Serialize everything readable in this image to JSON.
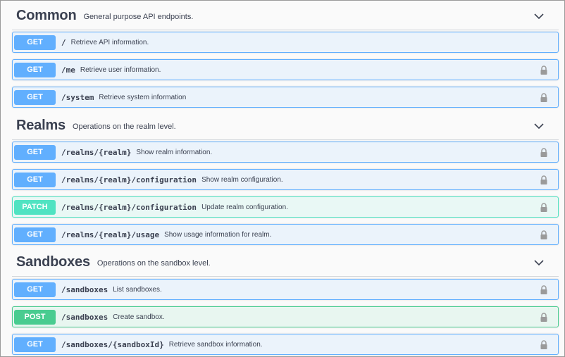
{
  "sections": [
    {
      "title": "Common",
      "description": "General purpose API endpoints.",
      "operations": [
        {
          "method": "GET",
          "path": "/",
          "summary": "Retrieve API information.",
          "locked": false
        },
        {
          "method": "GET",
          "path": "/me",
          "summary": "Retrieve user information.",
          "locked": true
        },
        {
          "method": "GET",
          "path": "/system",
          "summary": "Retrieve system information",
          "locked": true
        }
      ]
    },
    {
      "title": "Realms",
      "description": "Operations on the realm level.",
      "operations": [
        {
          "method": "GET",
          "path": "/realms/{realm}",
          "summary": "Show realm information.",
          "locked": true
        },
        {
          "method": "GET",
          "path": "/realms/{realm}/configuration",
          "summary": "Show realm configuration.",
          "locked": true
        },
        {
          "method": "PATCH",
          "path": "/realms/{realm}/configuration",
          "summary": "Update realm configuration.",
          "locked": true
        },
        {
          "method": "GET",
          "path": "/realms/{realm}/usage",
          "summary": "Show usage information for realm.",
          "locked": true
        }
      ]
    },
    {
      "title": "Sandboxes",
      "description": "Operations on the sandbox level.",
      "operations": [
        {
          "method": "GET",
          "path": "/sandboxes",
          "summary": "List sandboxes.",
          "locked": true
        },
        {
          "method": "POST",
          "path": "/sandboxes",
          "summary": "Create sandbox.",
          "locked": true
        },
        {
          "method": "GET",
          "path": "/sandboxes/{sandboxId}",
          "summary": "Retrieve sandbox information.",
          "locked": true
        }
      ]
    }
  ],
  "colors": {
    "get": "#61affe",
    "patch": "#50e3c2",
    "post": "#49cc90"
  },
  "icons": {
    "section_toggle": "chevron-down-icon",
    "auth": "lock-icon"
  }
}
